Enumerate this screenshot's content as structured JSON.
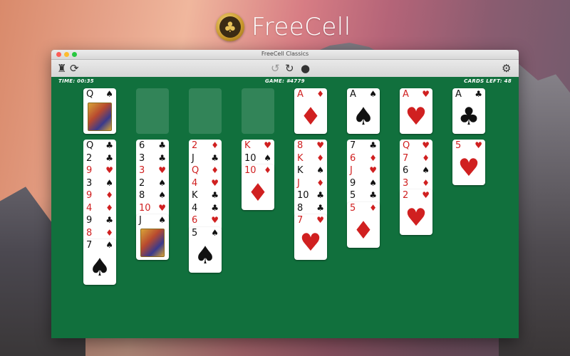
{
  "app": {
    "title": "FreeCell",
    "logo_glyph": "♣"
  },
  "window": {
    "title": "FreeCell Classics"
  },
  "toolbar": {
    "icons": {
      "rook": "♜",
      "shuffle": "⟳",
      "undo": "↺",
      "redo": "↻",
      "hint": "●",
      "gear": "⚙"
    }
  },
  "status": {
    "time": "TIME: 00:35",
    "game": "GAME: #4779",
    "cards_left": "CARDS LEFT: 48"
  },
  "free_cells": [
    {
      "rank": "Q",
      "suit": "♠",
      "color": "black",
      "face": true
    },
    null,
    null,
    null
  ],
  "foundations": [
    {
      "rank": "A",
      "suit": "♦",
      "color": "red"
    },
    {
      "rank": "A",
      "suit": "♠",
      "color": "black"
    },
    {
      "rank": "A",
      "suit": "♥",
      "color": "red"
    },
    {
      "rank": "A",
      "suit": "♣",
      "color": "black"
    }
  ],
  "tableau": [
    [
      {
        "rank": "Q",
        "suit": "♣",
        "color": "black"
      },
      {
        "rank": "2",
        "suit": "♣",
        "color": "black"
      },
      {
        "rank": "9",
        "suit": "♥",
        "color": "red"
      },
      {
        "rank": "3",
        "suit": "♠",
        "color": "black"
      },
      {
        "rank": "9",
        "suit": "♦",
        "color": "red"
      },
      {
        "rank": "4",
        "suit": "♦",
        "color": "red"
      },
      {
        "rank": "9",
        "suit": "♣",
        "color": "black"
      },
      {
        "rank": "8",
        "suit": "♦",
        "color": "red"
      },
      {
        "rank": "7",
        "suit": "♠",
        "color": "black"
      }
    ],
    [
      {
        "rank": "6",
        "suit": "♣",
        "color": "black"
      },
      {
        "rank": "3",
        "suit": "♣",
        "color": "black"
      },
      {
        "rank": "3",
        "suit": "♥",
        "color": "red"
      },
      {
        "rank": "2",
        "suit": "♠",
        "color": "black"
      },
      {
        "rank": "8",
        "suit": "♠",
        "color": "black"
      },
      {
        "rank": "10",
        "suit": "♥",
        "color": "red"
      },
      {
        "rank": "J",
        "suit": "♠",
        "color": "black",
        "face": true
      }
    ],
    [
      {
        "rank": "2",
        "suit": "♦",
        "color": "red"
      },
      {
        "rank": "J",
        "suit": "♣",
        "color": "black"
      },
      {
        "rank": "Q",
        "suit": "♦",
        "color": "red"
      },
      {
        "rank": "4",
        "suit": "♥",
        "color": "red"
      },
      {
        "rank": "K",
        "suit": "♣",
        "color": "black"
      },
      {
        "rank": "4",
        "suit": "♣",
        "color": "black"
      },
      {
        "rank": "6",
        "suit": "♥",
        "color": "red"
      },
      {
        "rank": "5",
        "suit": "♠",
        "color": "black"
      }
    ],
    [
      {
        "rank": "K",
        "suit": "♥",
        "color": "red"
      },
      {
        "rank": "10",
        "suit": "♠",
        "color": "black"
      },
      {
        "rank": "10",
        "suit": "♦",
        "color": "red"
      }
    ],
    [
      {
        "rank": "8",
        "suit": "♥",
        "color": "red"
      },
      {
        "rank": "K",
        "suit": "♦",
        "color": "red"
      },
      {
        "rank": "K",
        "suit": "♠",
        "color": "black"
      },
      {
        "rank": "J",
        "suit": "♦",
        "color": "red"
      },
      {
        "rank": "10",
        "suit": "♣",
        "color": "black"
      },
      {
        "rank": "8",
        "suit": "♣",
        "color": "black"
      },
      {
        "rank": "7",
        "suit": "♥",
        "color": "red"
      }
    ],
    [
      {
        "rank": "7",
        "suit": "♣",
        "color": "black"
      },
      {
        "rank": "6",
        "suit": "♦",
        "color": "red"
      },
      {
        "rank": "J",
        "suit": "♥",
        "color": "red"
      },
      {
        "rank": "9",
        "suit": "♠",
        "color": "black"
      },
      {
        "rank": "5",
        "suit": "♣",
        "color": "black"
      },
      {
        "rank": "5",
        "suit": "♦",
        "color": "red"
      }
    ],
    [
      {
        "rank": "Q",
        "suit": "♥",
        "color": "red"
      },
      {
        "rank": "7",
        "suit": "♦",
        "color": "red"
      },
      {
        "rank": "6",
        "suit": "♠",
        "color": "black"
      },
      {
        "rank": "3",
        "suit": "♦",
        "color": "red"
      },
      {
        "rank": "2",
        "suit": "♥",
        "color": "red"
      }
    ],
    [
      {
        "rank": "5",
        "suit": "♥",
        "color": "red"
      }
    ]
  ]
}
